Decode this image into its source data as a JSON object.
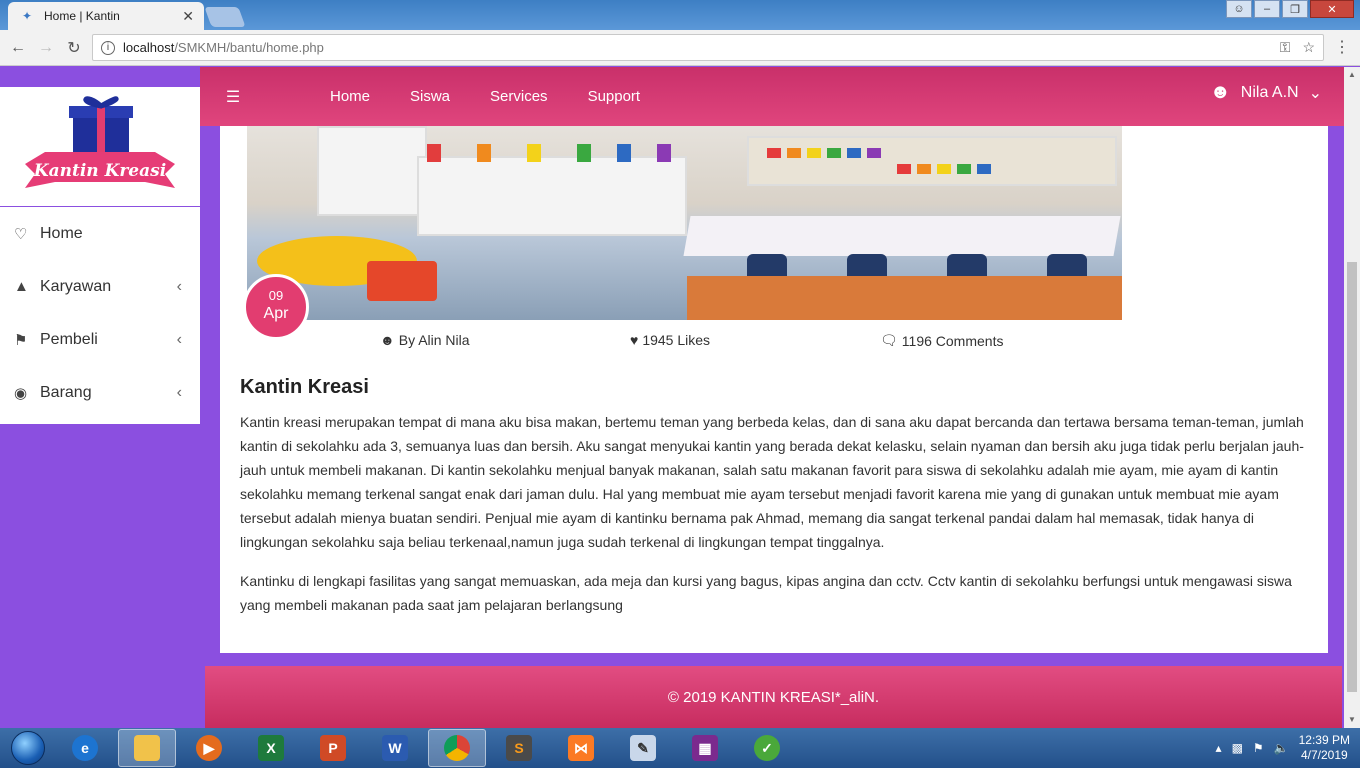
{
  "browser": {
    "tab_title": "Home | Kantin",
    "url_host": "localhost",
    "url_path": "/SMKMH/bantu/home.php"
  },
  "sidebar": {
    "logo_text": "Kantin Kreasi",
    "items": [
      {
        "label": "Home",
        "icon": "heart-icon"
      },
      {
        "label": "Karyawan",
        "icon": "tree-icon"
      },
      {
        "label": "Pembeli",
        "icon": "tags-icon"
      },
      {
        "label": "Barang",
        "icon": "drop-icon"
      }
    ]
  },
  "topnav": {
    "links": [
      "Home",
      "Siswa",
      "Services",
      "Support"
    ],
    "user_name": "Nila A.N"
  },
  "post": {
    "date_day": "09",
    "date_month": "Apr",
    "author": "By Alin Nila",
    "likes": "1945 Likes",
    "comments": "1196 Comments",
    "title": "Kantin Kreasi",
    "paragraph1": "Kantin kreasi merupakan tempat di mana aku bisa makan, bertemu teman yang berbeda kelas, dan di sana aku dapat bercanda dan tertawa bersama teman-teman, jumlah kantin di sekolahku ada 3, semuanya luas dan bersih. Aku sangat menyukai kantin yang berada dekat kelasku, selain nyaman dan bersih aku juga tidak perlu berjalan jauh-jauh untuk membeli makanan. Di kantin sekolahku menjual banyak makanan, salah satu makanan favorit para siswa di sekolahku adalah mie ayam, mie ayam di kantin sekolahku memang terkenal sangat enak dari jaman dulu. Hal yang membuat mie ayam tersebut menjadi favorit karena mie yang di gunakan untuk membuat mie ayam tersebut adalah mienya buatan sendiri. Penjual mie ayam di kantinku bernama pak Ahmad, memang dia sangat terkenal pandai dalam hal memasak, tidak hanya di lingkungan sekolahku saja beliau terkenaal,namun juga sudah terkenal di lingkungan tempat tinggalnya.",
    "paragraph2": "Kantinku di lengkapi fasilitas yang sangat memuaskan, ada meja dan kursi yang bagus, kipas angina dan cctv. Cctv kantin di sekolahku berfungsi untuk mengawasi siswa yang membeli makanan pada saat jam pelajaran berlangsung"
  },
  "footer": {
    "text": "© 2019 KANTIN KREASI*_aliN."
  },
  "taskbar": {
    "time": "12:39 PM",
    "date": "4/7/2019"
  },
  "colors": {
    "sidebar_bg": "#8b4fe0",
    "accent_pink": "#e0457d",
    "footer_pink": "#d63a70"
  }
}
